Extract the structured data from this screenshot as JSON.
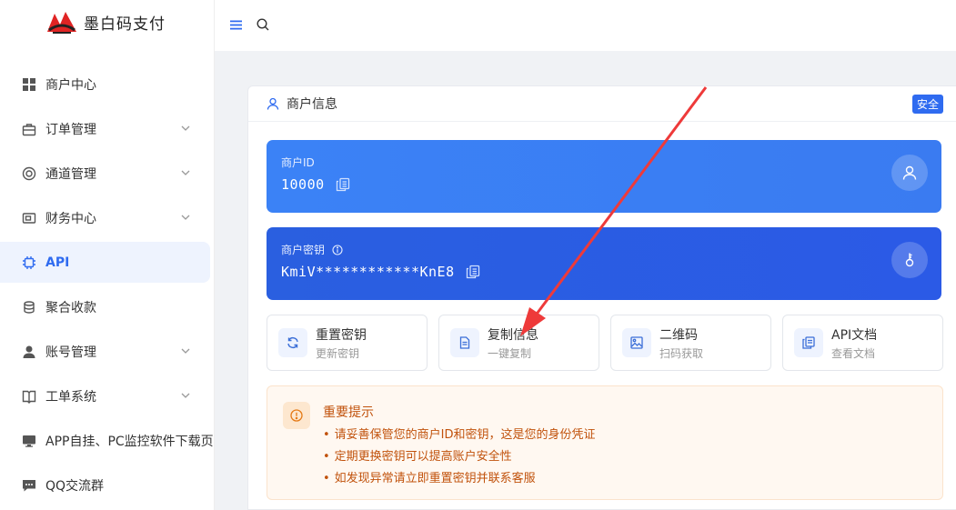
{
  "brand": {
    "name": "墨白码支付"
  },
  "sidebar": {
    "items": [
      {
        "label": "商户中心",
        "icon": "grid-icon",
        "expandable": false,
        "active": false
      },
      {
        "label": "订单管理",
        "icon": "bag-icon",
        "expandable": true,
        "active": false
      },
      {
        "label": "通道管理",
        "icon": "ring-icon",
        "expandable": true,
        "active": false
      },
      {
        "label": "财务中心",
        "icon": "wallet-icon",
        "expandable": true,
        "active": false
      },
      {
        "label": "API",
        "icon": "chip-icon",
        "expandable": false,
        "active": true
      },
      {
        "label": "聚合收款",
        "icon": "coins-icon",
        "expandable": false,
        "active": false
      },
      {
        "label": "账号管理",
        "icon": "user-icon",
        "expandable": true,
        "active": false
      },
      {
        "label": "工单系统",
        "icon": "book-icon",
        "expandable": true,
        "active": false
      },
      {
        "label": "APP自挂、PC监控软件下载页",
        "icon": "monitor-icon",
        "expandable": false,
        "active": false
      },
      {
        "label": "QQ交流群",
        "icon": "chat-icon",
        "expandable": false,
        "active": false
      }
    ]
  },
  "topbar": {
    "menu_icon": "menu-toggle-icon",
    "search_icon": "search-icon"
  },
  "card": {
    "title": "商户信息",
    "badge": "安全",
    "merchant_id": {
      "label": "商户ID",
      "value": "10000"
    },
    "merchant_key": {
      "label": "商户密钥",
      "value": "KmiV************KnE8"
    },
    "actions": [
      {
        "title": "重置密钥",
        "sub": "更新密钥",
        "icon": "refresh-icon"
      },
      {
        "title": "复制信息",
        "sub": "一键复制",
        "icon": "document-icon"
      },
      {
        "title": "二维码",
        "sub": "扫码获取",
        "icon": "image-icon"
      },
      {
        "title": "API文档",
        "sub": "查看文档",
        "icon": "docs-icon"
      }
    ],
    "notice": {
      "title": "重要提示",
      "items": [
        "请妥善保管您的商户ID和密钥，这是您的身份凭证",
        "定期更换密钥可以提高账户安全性",
        "如发现异常请立即重置密钥并联系客服"
      ]
    }
  },
  "colors": {
    "accent": "#2f6bf0",
    "panel_id": "#3b82f6",
    "panel_key": "#2a5fe0",
    "notice_text": "#c1520c",
    "arrow": "#ee3a3a"
  }
}
